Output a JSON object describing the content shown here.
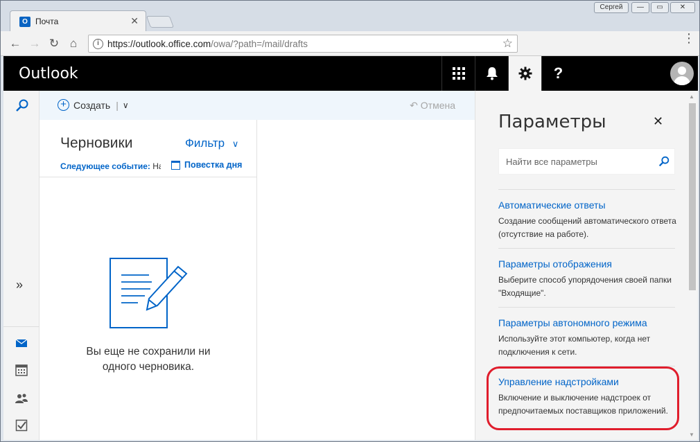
{
  "browser": {
    "tab_title": "Почта",
    "tab_favicon": "O",
    "tab_close": "✕",
    "profile": "Сергей",
    "window_buttons": {
      "minimize": "—",
      "maximize": "▭",
      "close": "✕"
    },
    "nav": {
      "back": "←",
      "forward": "→",
      "reload": "↻",
      "home": "⌂"
    },
    "url_host": "https://outlook.office.com",
    "url_path": "/owa/?path=/mail/drafts",
    "info_glyph": "i",
    "star_glyph": "☆",
    "menu_glyph": "⋮"
  },
  "header": {
    "brand": "Outlook",
    "buttons": [
      {
        "name": "app-launcher",
        "glyph": "⊞"
      },
      {
        "name": "notifications",
        "glyph": "🔔"
      },
      {
        "name": "settings",
        "glyph": "⚙",
        "active": true
      },
      {
        "name": "help",
        "glyph": "?"
      }
    ]
  },
  "left_rail": {
    "expand": "»",
    "icons": [
      "search-icon",
      "mail-icon",
      "calendar-icon",
      "people-icon",
      "tasks-icon"
    ]
  },
  "command_bar": {
    "create_label": "Создать",
    "create_plus": "+",
    "separator": "|",
    "chevron": "∨",
    "undo_label": "Отмена",
    "undo_glyph": "↶"
  },
  "folder": {
    "title": "Черновики",
    "filter_label": "Фильтр",
    "filter_chevron": "∨",
    "next_event_label": "Следующее событие:",
    "next_event_value": " На се",
    "agenda_label": "Повестка дня",
    "empty_line1": "Вы еще не сохранили ни",
    "empty_line2": "одного черновика."
  },
  "settings": {
    "title": "Параметры",
    "close": "✕",
    "search_placeholder": "Найти все параметры",
    "items": [
      {
        "link": "Автоматические ответы",
        "desc": "Создание сообщений автоматического ответа (отсутствие на работе)."
      },
      {
        "link": "Параметры отображения",
        "desc": "Выберите способ упорядочения своей папки \"Входящие\"."
      },
      {
        "link": "Параметры автономного режима",
        "desc": "Используйте этот компьютер, когда нет подключения к сети."
      },
      {
        "link": "Управление надстройками",
        "desc": "Включение и выключение надстроек от предпочитаемых поставщиков приложений."
      }
    ],
    "highlight_color": "#e01d2c"
  },
  "colors": {
    "accent": "#0064c8",
    "header_bg": "#000000",
    "command_bar_bg": "#eff6fc",
    "panel_bg": "#f4f4f4"
  }
}
